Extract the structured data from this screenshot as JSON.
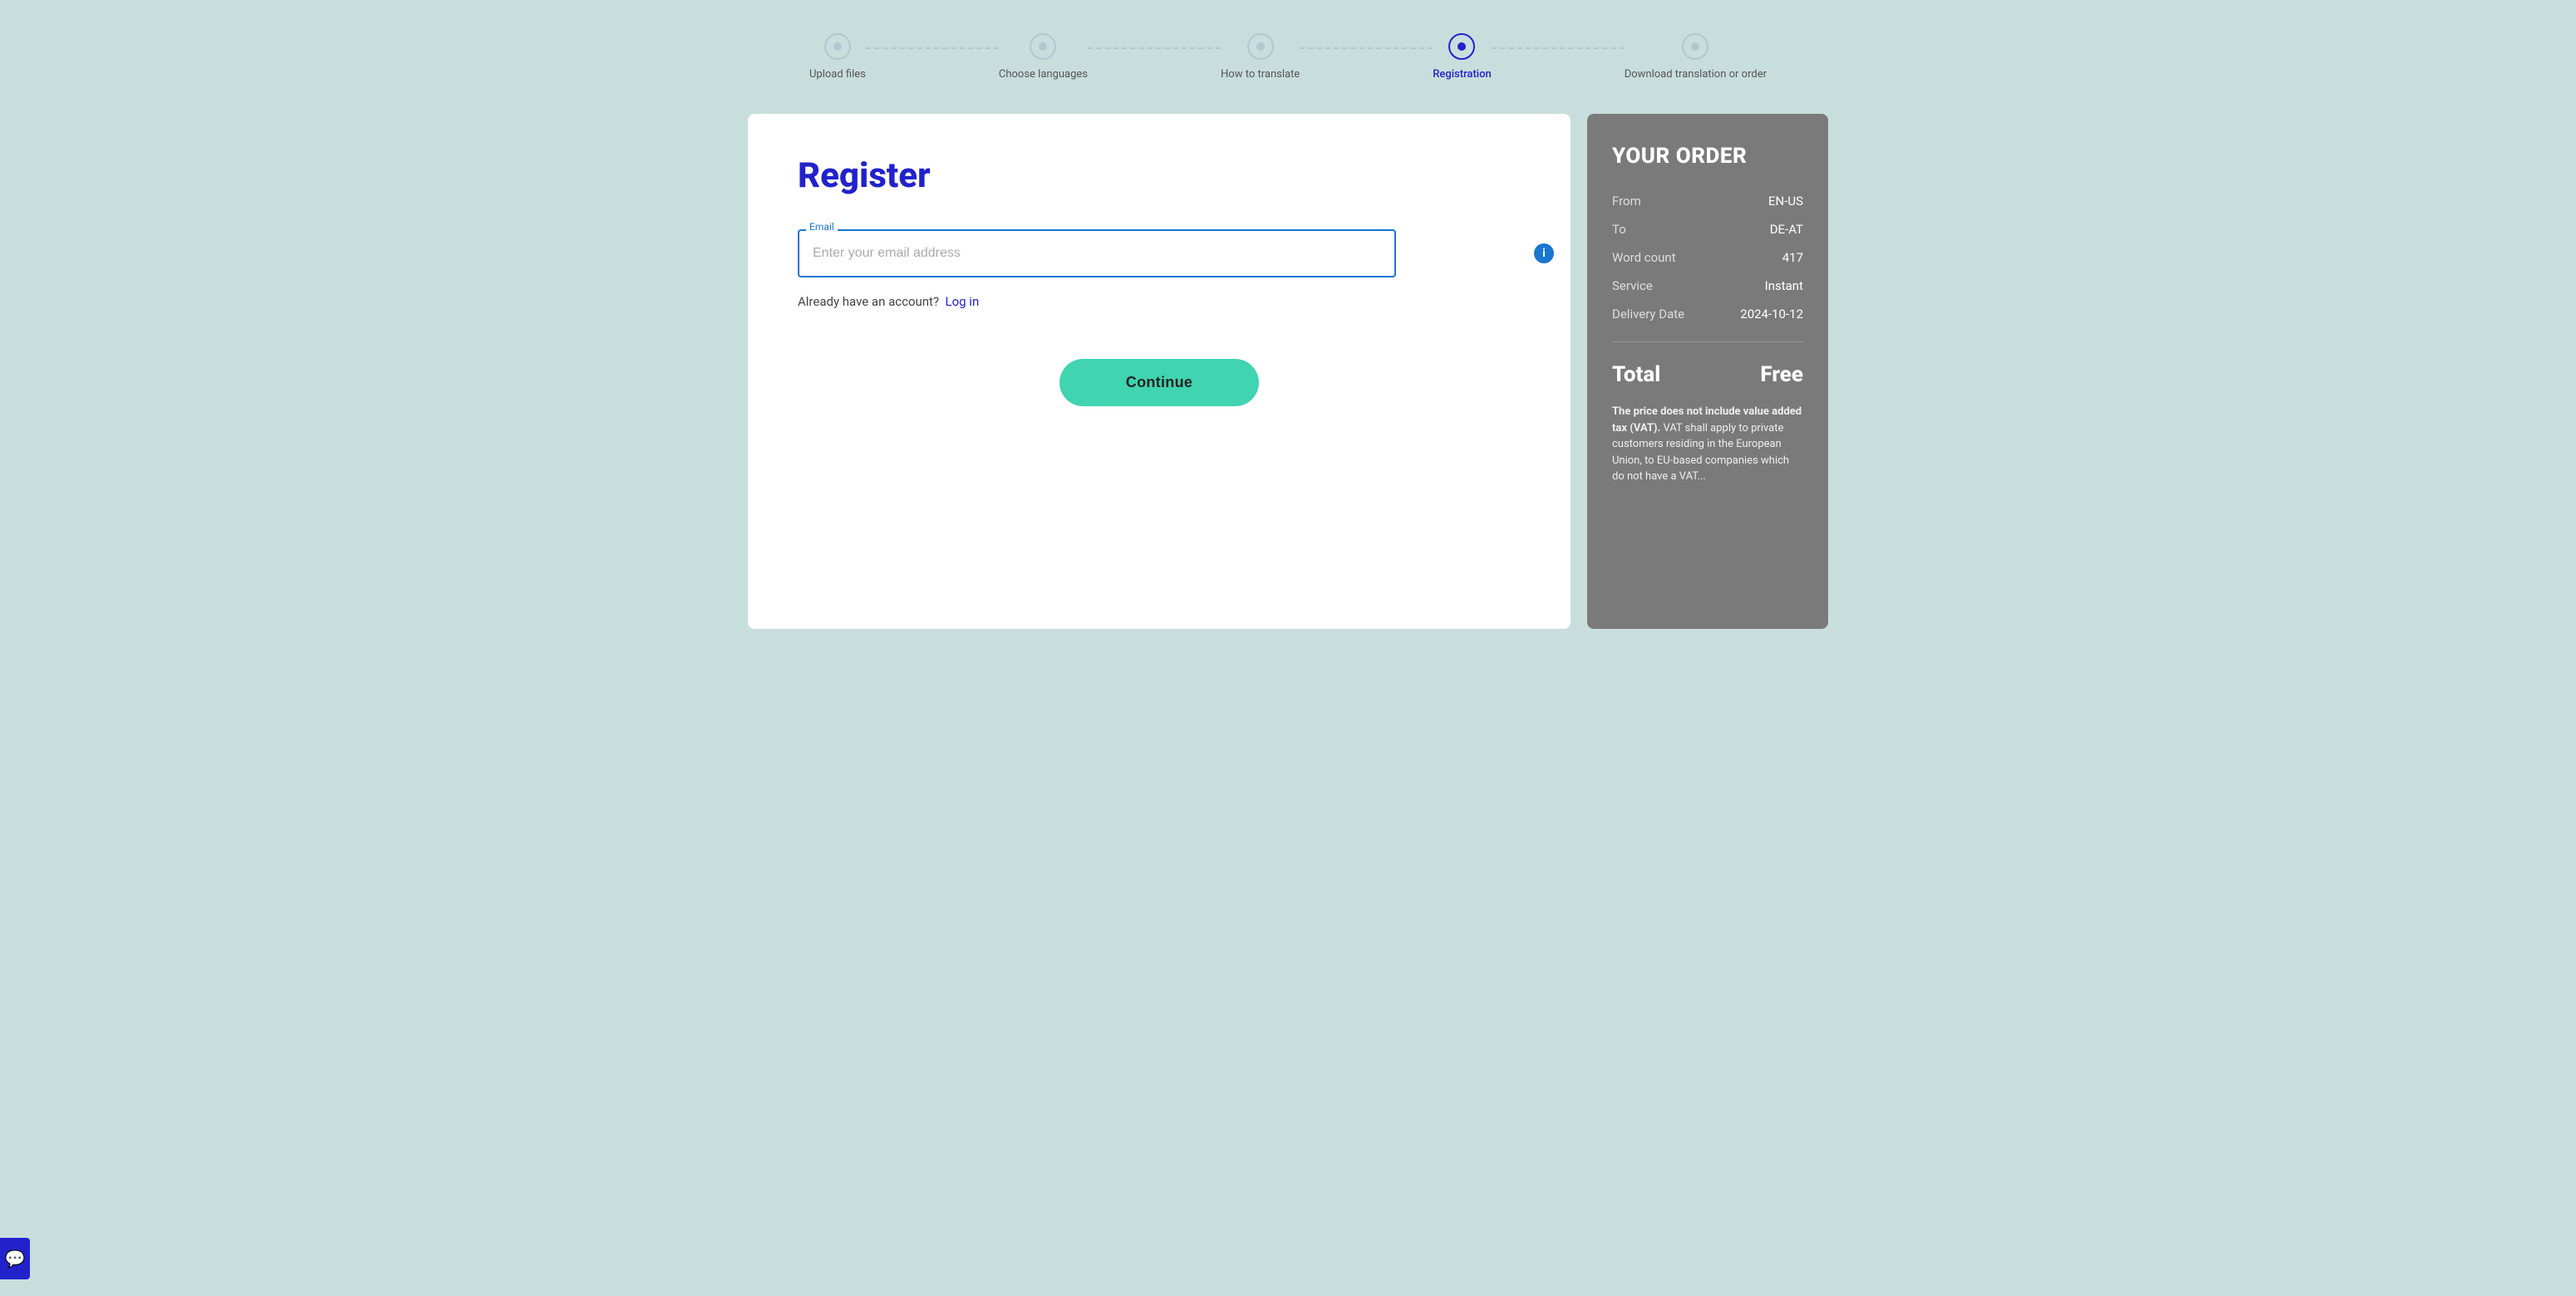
{
  "stepper": {
    "steps": [
      {
        "id": "upload",
        "label": "Upload files",
        "state": "completed"
      },
      {
        "id": "choose-languages",
        "label": "Choose languages",
        "state": "completed"
      },
      {
        "id": "how-to-translate",
        "label": "How to translate",
        "state": "completed"
      },
      {
        "id": "registration",
        "label": "Registration",
        "state": "active"
      },
      {
        "id": "download",
        "label": "Download translation or order",
        "state": "upcoming"
      }
    ]
  },
  "form": {
    "title": "Register",
    "email_label": "Email",
    "email_placeholder": "Enter your email address",
    "already_account_text": "Already have an account?",
    "login_link_text": "Log in",
    "continue_button": "Continue",
    "info_icon_text": "i"
  },
  "order": {
    "title": "YOUR ORDER",
    "from_label": "From",
    "from_value": "EN-US",
    "to_label": "To",
    "to_value": "DE-AT",
    "word_count_label": "Word count",
    "word_count_value": "417",
    "service_label": "Service",
    "service_value": "Instant",
    "delivery_date_label": "Delivery Date",
    "delivery_date_value": "2024-10-12",
    "total_label": "Total",
    "total_value": "Free",
    "vat_bold": "The price does not include value added tax (VAT).",
    "vat_text": " VAT shall apply to private customers residing in the European Union, to EU-based companies which do not have a VAT..."
  },
  "colors": {
    "active_blue": "#2222cc",
    "teal": "#40d4b0",
    "grey_panel": "#7a7a7a",
    "bg": "#c8dedd"
  }
}
